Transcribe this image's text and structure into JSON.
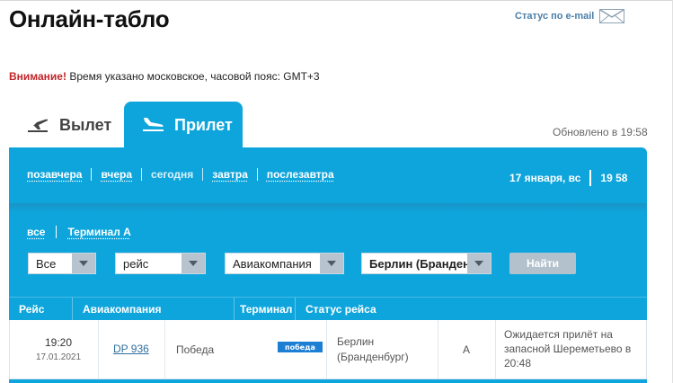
{
  "header": {
    "title": "Онлайн-табло",
    "status_email": "Статус по e-mail"
  },
  "notice": {
    "warning": "Внимание!",
    "text": " Время указано московское, часовой пояс: GMT+3"
  },
  "tabs": [
    {
      "label": "Вылет",
      "icon": "departure-plane-icon",
      "active": false
    },
    {
      "label": "Прилет",
      "icon": "arrival-plane-icon",
      "active": true
    }
  ],
  "updated": "Обновлено в 19:58",
  "days": [
    "позавчера",
    "вчера",
    "сегодня",
    "завтра",
    "послезавтра"
  ],
  "current": {
    "date": "17 января, вс",
    "time": "19 58"
  },
  "terminals": [
    "все",
    "Терминал А"
  ],
  "filters": {
    "all": "Все",
    "flight": "рейс",
    "airline": "Авиакомпания",
    "city": "Берлин (Бранденб",
    "find_button": "Найти"
  },
  "table": {
    "headers": [
      "Рейс",
      "Авиакомпания",
      "Терминал",
      "Статус рейса"
    ],
    "rows": [
      {
        "time": "19:20",
        "date": "17.01.2021",
        "flight": "DP 936",
        "airline": "Победа",
        "logo_text": "победа",
        "city": "Берлин (Бранденбург)",
        "terminal": "A",
        "status": "Ожидается прилёт на запасной Шереметьево в 20:48"
      }
    ]
  },
  "colors": {
    "accent": "#0ea5dc",
    "warning": "#c0252a",
    "link": "#2f6f9f"
  }
}
